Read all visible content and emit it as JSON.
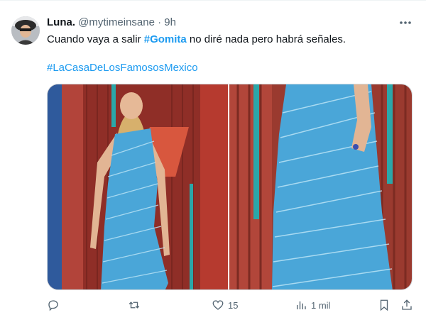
{
  "tweet": {
    "author_name": "Luna.",
    "handle": "@mytimeinsane",
    "separator": "·",
    "time": "9h",
    "text_before": "Cuando vaya a salir ",
    "hashtag_inline": "#Gomita",
    "text_after": " no diré nada pero habrá señales.",
    "hashtag_line": "#LaCasaDeLosFamososMexico"
  },
  "actions": {
    "reply_count": "",
    "retweet_count": "",
    "like_count": "15",
    "views_count": "1 mil"
  },
  "icons": [
    "more-icon",
    "reply-icon",
    "retweet-icon",
    "like-icon",
    "views-icon",
    "bookmark-icon",
    "share-icon"
  ],
  "colors": {
    "link": "#1d9bf0",
    "muted": "#536471",
    "text": "#0f1419",
    "dress": "#4aa6d8",
    "stage_red": "#a8362c"
  }
}
